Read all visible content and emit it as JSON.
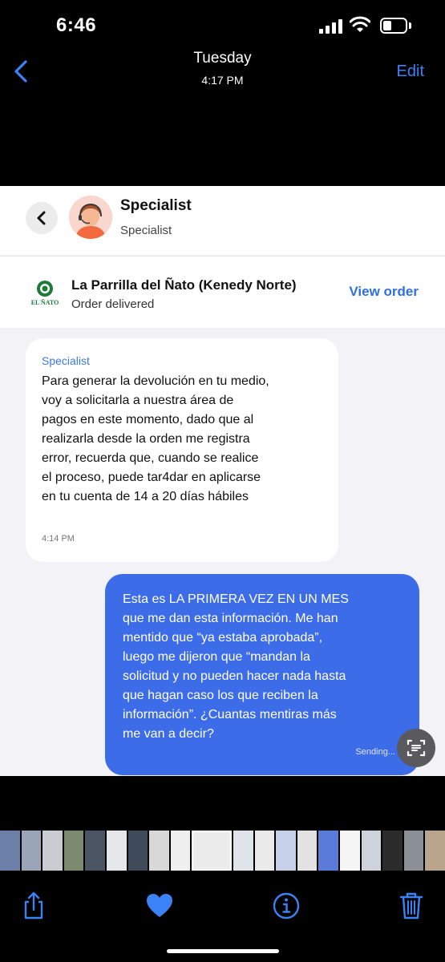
{
  "status_bar": {
    "time": "6:46"
  },
  "photo_header": {
    "day": "Tuesday",
    "time": "4:17 PM",
    "edit_label": "Edit"
  },
  "chat": {
    "agent_name": "Specialist",
    "agent_role": "Specialist",
    "restaurant_logo_text": "EL ÑATO",
    "restaurant_name": "La Parrilla del Ñato (Kenedy Norte)",
    "order_status": "Order delivered",
    "view_order_label": "View order",
    "messages": [
      {
        "sender": "Specialist",
        "text": "Para generar la devolución en tu medio,\nvoy a solicitarla a nuestra área de\npagos en este momento, dado que al\nrealizarla desde la orden me registra\nerror, recuerda que, cuando se realice\nel proceso, puede tar4dar en aplicarse\nen tu cuenta de 14 a 20 días hábiles",
        "time": "4:14 PM"
      },
      {
        "text": "Esta es LA PRIMERA VEZ EN UN MES\nque me dan esta información. Me han\nmentido que “ya estaba aprobada”,\nluego me dijeron que “mandan la\nsolicitud y no pueden hacer nada hasta\nque hagan caso los que reciben la\ninformación”. ¿Cuantas mentiras más\nme van a decir?",
        "status": "Sending..."
      }
    ]
  },
  "icons": {
    "back": "chevron-left-icon",
    "share": "share-icon",
    "favorite": "heart-icon",
    "info": "info-icon",
    "delete": "trash-icon",
    "live_text": "live-text-icon"
  },
  "colors": {
    "accent": "#2f6fe0",
    "outgoing_bubble": "#3d6ce8",
    "ios_blue": "#3b82f6"
  }
}
